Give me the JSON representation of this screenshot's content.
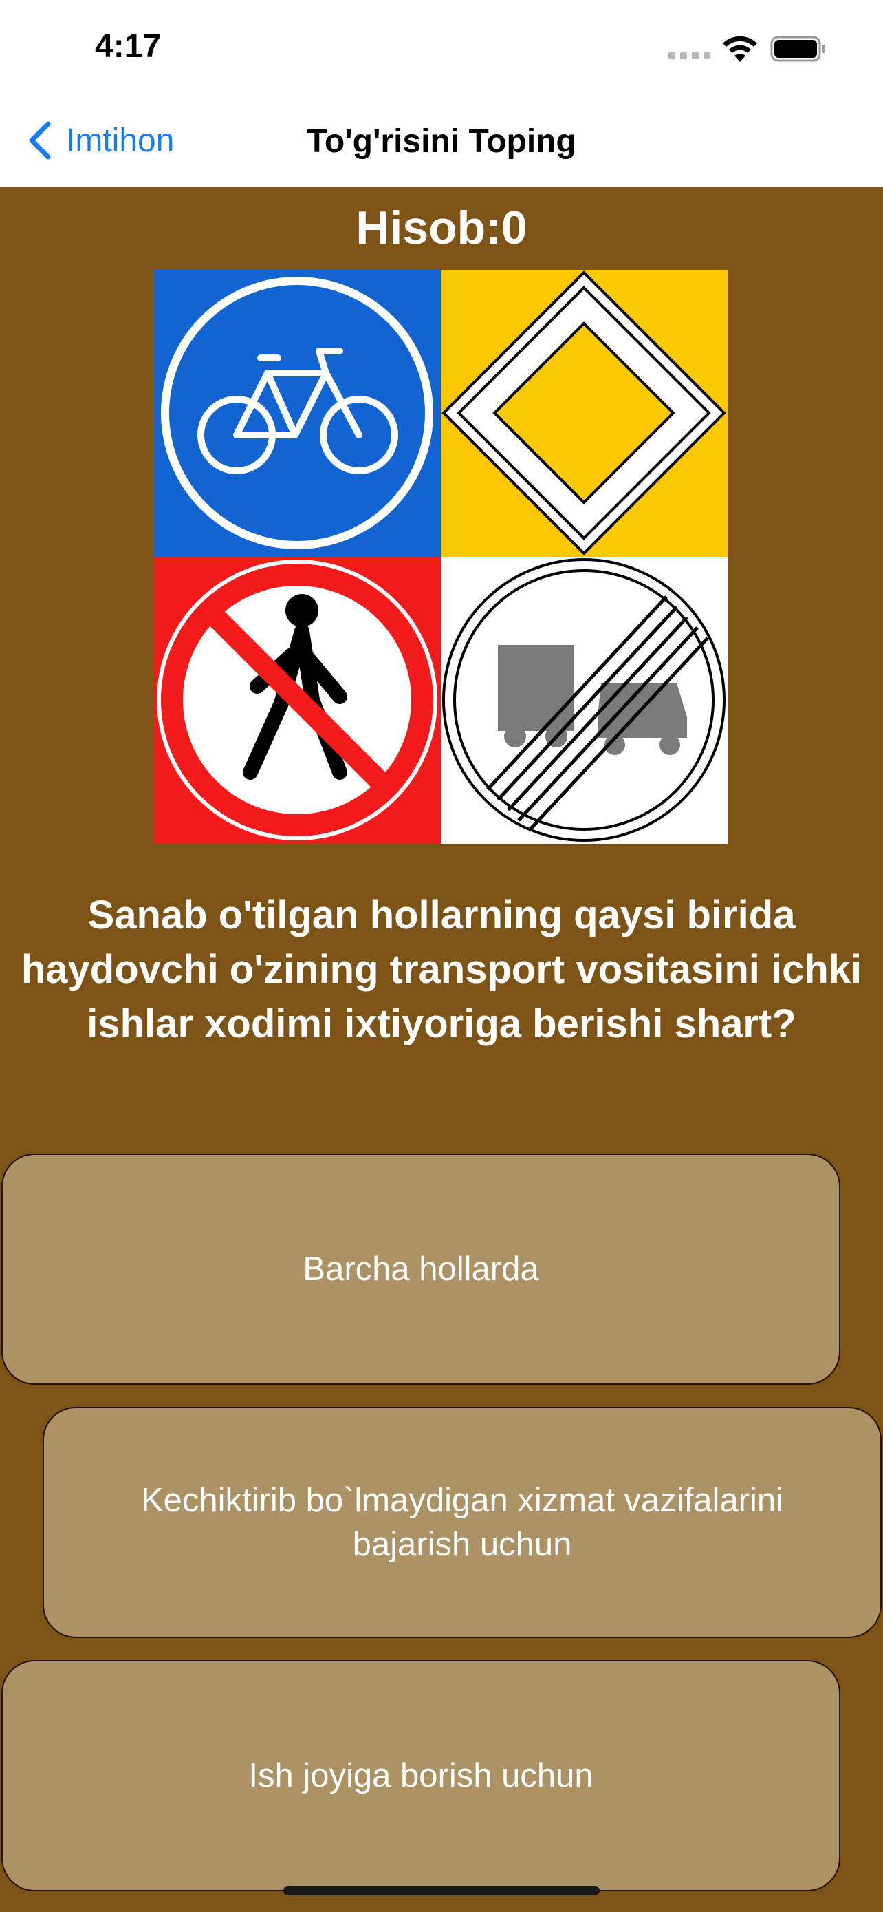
{
  "status": {
    "time": "4:17"
  },
  "nav": {
    "back_label": "Imtihon",
    "title": "To'g'risini Toping"
  },
  "score": {
    "text": "Hisob:0"
  },
  "image": {
    "signs": [
      "bicycle-path-icon",
      "priority-road-icon",
      "no-pedestrians-icon",
      "end-of-no-overtaking-trucks-icon"
    ],
    "colors": {
      "blue": "#1264d2",
      "yellow": "#fac800",
      "red": "#f21a1a",
      "white": "#ffffff"
    }
  },
  "question": {
    "text": "Sanab o'tilgan hollarning qaysi birida haydovchi o'zining transport vositasini ichki ishlar xodimi ixtiyoriga berishi shart?"
  },
  "answers": [
    {
      "label": "Barcha hollarda"
    },
    {
      "label": "Kechiktirib bo`lmaydigan xizmat vazifalarini bajarish uchun"
    },
    {
      "label": "Ish joyiga borish uchun"
    }
  ],
  "colors": {
    "background": "#7e5416",
    "answer_bg": "#ad9265",
    "link": "#1a7cf4"
  }
}
